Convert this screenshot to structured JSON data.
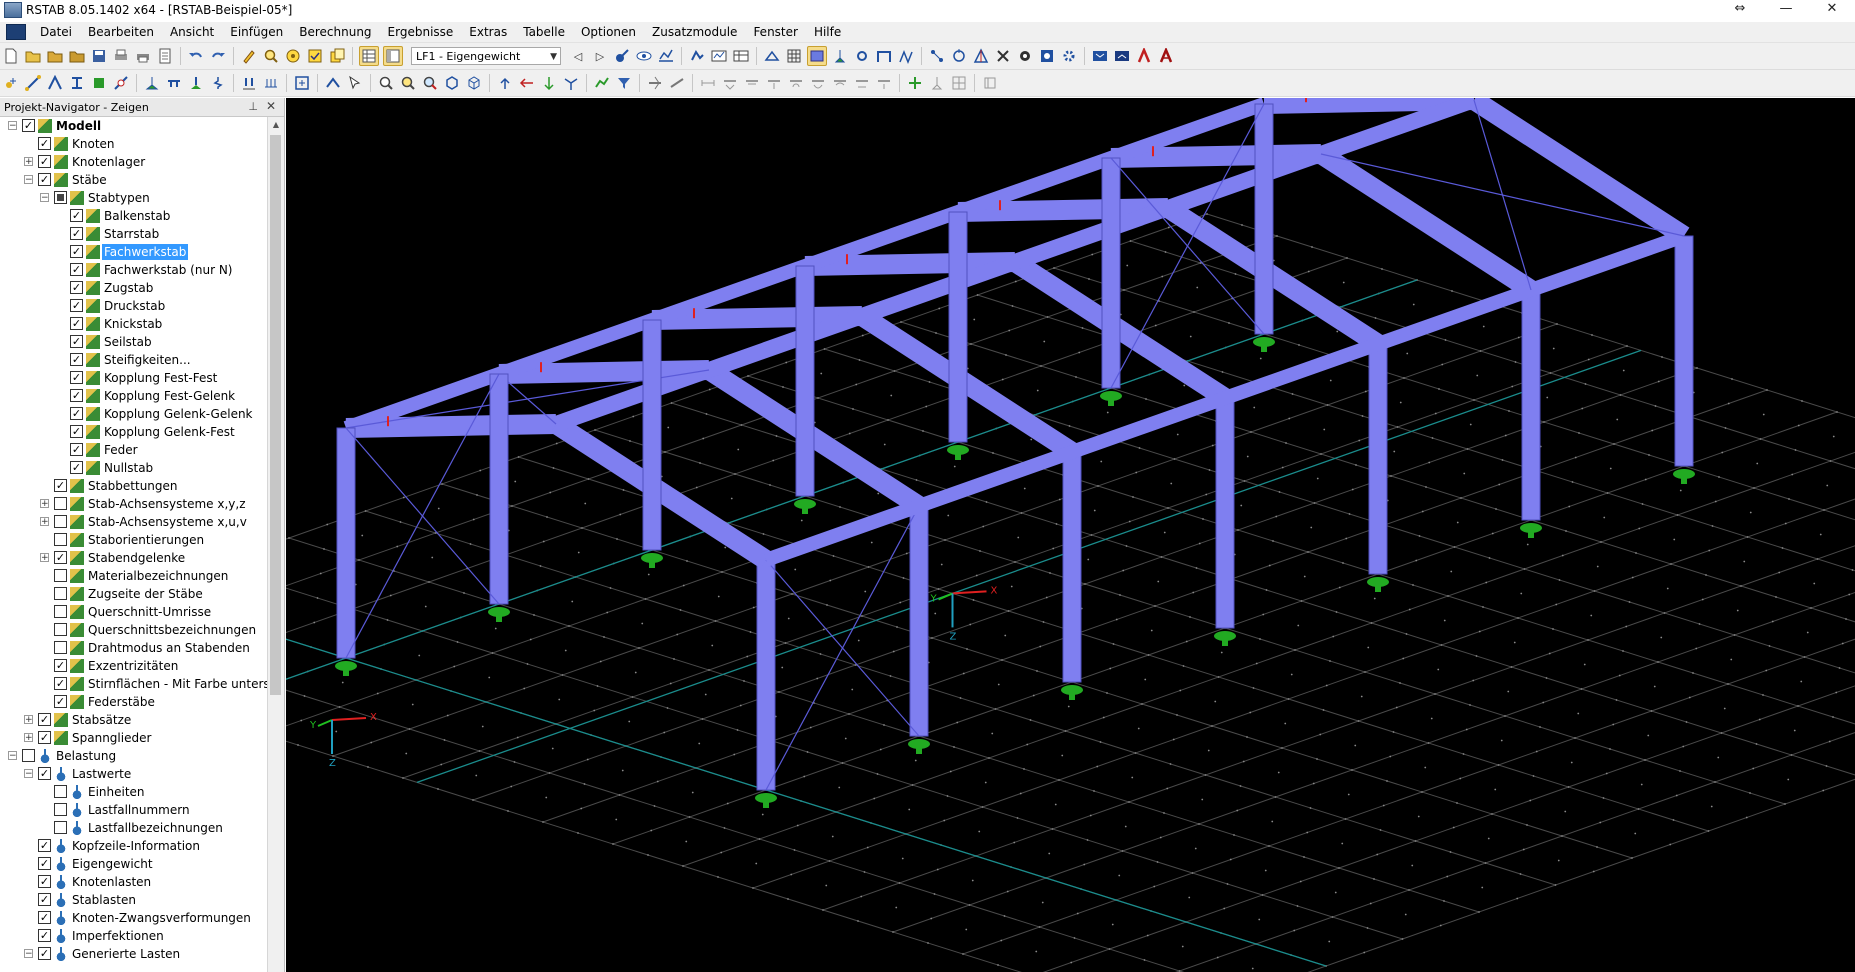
{
  "window": {
    "title": "RSTAB 8.05.1402 x64 - [RSTAB-Beispiel-05*]",
    "controls": [
      "⇔",
      "—",
      "✕"
    ]
  },
  "menu": [
    "Datei",
    "Bearbeiten",
    "Ansicht",
    "Einfügen",
    "Berechnung",
    "Ergebnisse",
    "Extras",
    "Tabelle",
    "Optionen",
    "Zusatzmodule",
    "Fenster",
    "Hilfe"
  ],
  "toolbar": {
    "load_case": "LF1 - Eigengewicht"
  },
  "navigator": {
    "title": "Projekt-Navigator - Zeigen",
    "pin": "⊥",
    "close": "✕",
    "items": [
      {
        "label": "Modell",
        "depth": 0,
        "expander": "-",
        "check": "on",
        "icon": "model",
        "bold": true
      },
      {
        "label": "Knoten",
        "depth": 1,
        "expander": "",
        "check": "on",
        "icon": "model"
      },
      {
        "label": "Knotenlager",
        "depth": 1,
        "expander": "+",
        "check": "on",
        "icon": "model"
      },
      {
        "label": "Stäbe",
        "depth": 1,
        "expander": "-",
        "check": "on",
        "icon": "model"
      },
      {
        "label": "Stabtypen",
        "depth": 2,
        "expander": "-",
        "check": "part",
        "icon": "model"
      },
      {
        "label": "Balkenstab",
        "depth": 3,
        "expander": "",
        "check": "on",
        "icon": "model"
      },
      {
        "label": "Starrstab",
        "depth": 3,
        "expander": "",
        "check": "on",
        "icon": "model"
      },
      {
        "label": "Fachwerkstab",
        "depth": 3,
        "expander": "",
        "check": "on",
        "icon": "model",
        "selected": true
      },
      {
        "label": "Fachwerkstab (nur N)",
        "depth": 3,
        "expander": "",
        "check": "on",
        "icon": "model"
      },
      {
        "label": "Zugstab",
        "depth": 3,
        "expander": "",
        "check": "on",
        "icon": "model"
      },
      {
        "label": "Druckstab",
        "depth": 3,
        "expander": "",
        "check": "on",
        "icon": "model"
      },
      {
        "label": "Knickstab",
        "depth": 3,
        "expander": "",
        "check": "on",
        "icon": "model"
      },
      {
        "label": "Seilstab",
        "depth": 3,
        "expander": "",
        "check": "on",
        "icon": "model"
      },
      {
        "label": "Steifigkeiten...",
        "depth": 3,
        "expander": "",
        "check": "on",
        "icon": "model"
      },
      {
        "label": "Kopplung Fest-Fest",
        "depth": 3,
        "expander": "",
        "check": "on",
        "icon": "model"
      },
      {
        "label": "Kopplung Fest-Gelenk",
        "depth": 3,
        "expander": "",
        "check": "on",
        "icon": "model"
      },
      {
        "label": "Kopplung Gelenk-Gelenk",
        "depth": 3,
        "expander": "",
        "check": "on",
        "icon": "model"
      },
      {
        "label": "Kopplung Gelenk-Fest",
        "depth": 3,
        "expander": "",
        "check": "on",
        "icon": "model"
      },
      {
        "label": "Feder",
        "depth": 3,
        "expander": "",
        "check": "on",
        "icon": "model"
      },
      {
        "label": "Nullstab",
        "depth": 3,
        "expander": "",
        "check": "on",
        "icon": "model"
      },
      {
        "label": "Stabbettungen",
        "depth": 2,
        "expander": "",
        "check": "on",
        "icon": "model"
      },
      {
        "label": "Stab-Achsensysteme x,y,z",
        "depth": 2,
        "expander": "+",
        "check": "off",
        "icon": "model"
      },
      {
        "label": "Stab-Achsensysteme x,u,v",
        "depth": 2,
        "expander": "+",
        "check": "off",
        "icon": "model"
      },
      {
        "label": "Staborientierungen",
        "depth": 2,
        "expander": "",
        "check": "off",
        "icon": "model"
      },
      {
        "label": "Stabendgelenke",
        "depth": 2,
        "expander": "+",
        "check": "on",
        "icon": "model"
      },
      {
        "label": "Materialbezeichnungen",
        "depth": 2,
        "expander": "",
        "check": "off",
        "icon": "model"
      },
      {
        "label": "Zugseite der Stäbe",
        "depth": 2,
        "expander": "",
        "check": "off",
        "icon": "model"
      },
      {
        "label": "Querschnitt-Umrisse",
        "depth": 2,
        "expander": "",
        "check": "off",
        "icon": "model"
      },
      {
        "label": "Querschnittsbezeichnungen",
        "depth": 2,
        "expander": "",
        "check": "off",
        "icon": "model"
      },
      {
        "label": "Drahtmodus an Stabenden",
        "depth": 2,
        "expander": "",
        "check": "off",
        "icon": "model"
      },
      {
        "label": "Exzentrizitäten",
        "depth": 2,
        "expander": "",
        "check": "on",
        "icon": "model"
      },
      {
        "label": "Stirnflächen - Mit Farbe untersc",
        "depth": 2,
        "expander": "",
        "check": "on",
        "icon": "model"
      },
      {
        "label": "Federstäbe",
        "depth": 2,
        "expander": "",
        "check": "on",
        "icon": "model"
      },
      {
        "label": "Stabsätze",
        "depth": 1,
        "expander": "+",
        "check": "on",
        "icon": "model"
      },
      {
        "label": "Spannglieder",
        "depth": 1,
        "expander": "+",
        "check": "on",
        "icon": "model"
      },
      {
        "label": "Belastung",
        "depth": 0,
        "expander": "-",
        "check": "off",
        "icon": "load"
      },
      {
        "label": "Lastwerte",
        "depth": 1,
        "expander": "-",
        "check": "on",
        "icon": "load"
      },
      {
        "label": "Einheiten",
        "depth": 2,
        "expander": "",
        "check": "off",
        "icon": "load"
      },
      {
        "label": "Lastfallnummern",
        "depth": 2,
        "expander": "",
        "check": "off",
        "icon": "load"
      },
      {
        "label": "Lastfallbezeichnungen",
        "depth": 2,
        "expander": "",
        "check": "off",
        "icon": "load"
      },
      {
        "label": "Kopfzeile-Information",
        "depth": 1,
        "expander": "",
        "check": "on",
        "icon": "load"
      },
      {
        "label": "Eigengewicht",
        "depth": 1,
        "expander": "",
        "check": "on",
        "icon": "load"
      },
      {
        "label": "Knotenlasten",
        "depth": 1,
        "expander": "",
        "check": "on",
        "icon": "load"
      },
      {
        "label": "Stablasten",
        "depth": 1,
        "expander": "",
        "check": "on",
        "icon": "load"
      },
      {
        "label": "Knoten-Zwangsverformungen",
        "depth": 1,
        "expander": "",
        "check": "on",
        "icon": "load"
      },
      {
        "label": "Imperfektionen",
        "depth": 1,
        "expander": "",
        "check": "on",
        "icon": "load"
      },
      {
        "label": "Generierte Lasten",
        "depth": 1,
        "expander": "-",
        "check": "on",
        "icon": "load"
      }
    ]
  },
  "viewport": {
    "axis_labels": {
      "x": "X",
      "y": "Y",
      "z": "Z"
    },
    "colors": {
      "background": "#000000",
      "member": "#7f7ff0",
      "member_edge": "#5050c0",
      "support": "#22aa22",
      "grid_dot": "#8a8a8a",
      "grid_line": "#4a4a4a",
      "axis_line": "#1a8c8c",
      "axis_x": "#e02020",
      "axis_y": "#20c020",
      "axis_z": "#20a0c0"
    }
  }
}
